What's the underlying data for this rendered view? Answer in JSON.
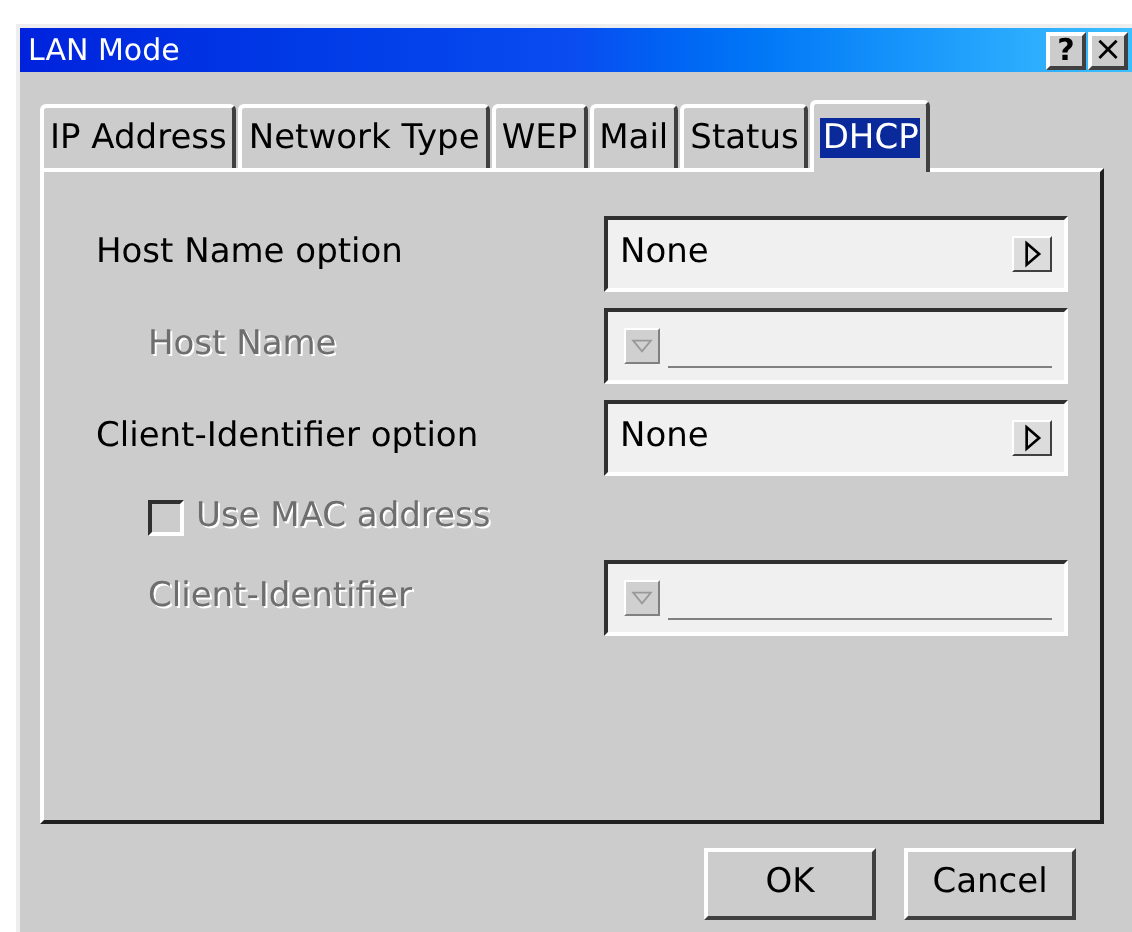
{
  "window": {
    "title": "LAN Mode",
    "help_button": "?",
    "close_button": "×"
  },
  "tabs": [
    {
      "label": "IP Address",
      "selected": false
    },
    {
      "label": "Network Type",
      "selected": false
    },
    {
      "label": "WEP",
      "selected": false
    },
    {
      "label": "Mail",
      "selected": false
    },
    {
      "label": "Status",
      "selected": false
    },
    {
      "label": "DHCP",
      "selected": true
    }
  ],
  "rows": [
    {
      "kind": "select",
      "label": "Host Name option",
      "value": "None",
      "disabled": false,
      "children": [
        {
          "kind": "text",
          "label": "Host Name",
          "disabled": true
        }
      ]
    },
    {
      "kind": "select",
      "label": "Client-Identifier option",
      "value": "None",
      "disabled": false,
      "children": [
        {
          "kind": "checkbox",
          "label": "Use MAC address",
          "checked": false,
          "disabled": true
        },
        {
          "kind": "text",
          "label": "Client-Identifier",
          "disabled": true
        }
      ]
    }
  ],
  "buttons": [
    "OK",
    "Cancel"
  ]
}
